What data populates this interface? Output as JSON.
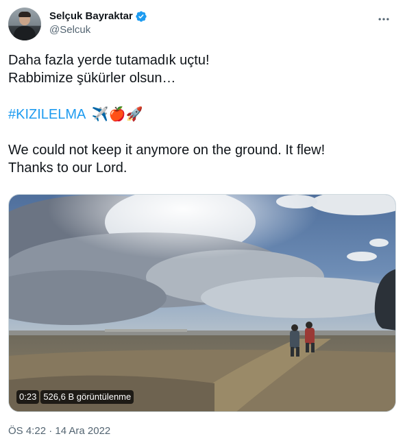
{
  "author": {
    "display_name": "Selçuk Bayraktar",
    "handle": "@Selcuk",
    "verified": true
  },
  "tweet": {
    "line1": "Daha fazla yerde tutamadık uçtu!",
    "line2": "Rabbimize şükürler olsun…",
    "hashtag": "#KIZILELMA",
    "emojis": "✈️🍎🚀",
    "line3": "We could not keep it anymore on the ground. It flew!",
    "line4": "Thanks to our Lord."
  },
  "video": {
    "duration": "0:23",
    "views": "526,6 B görüntülenme"
  },
  "timestamp": "ÖS 4:22 · 14 Ara 2022",
  "colors": {
    "link": "#1d9bf0",
    "verified": "#1d9bf0",
    "secondary_text": "#536471"
  },
  "icons": [
    "verified-badge-icon",
    "more-options-icon"
  ]
}
